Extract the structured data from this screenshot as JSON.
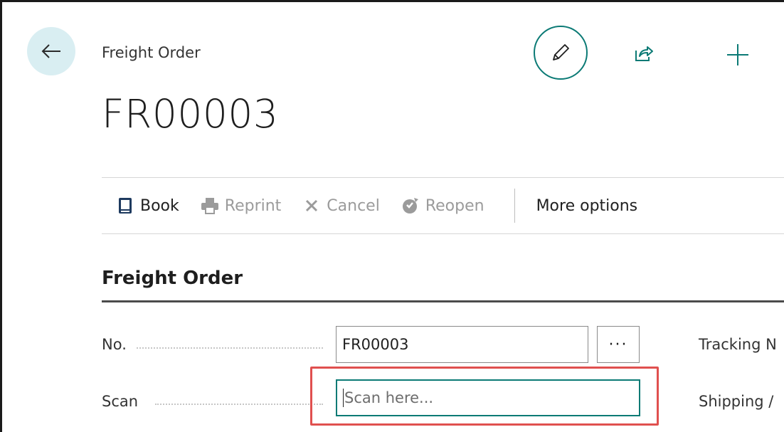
{
  "header": {
    "caption": "Freight Order",
    "record_no": "FR00003"
  },
  "icons": {
    "back": "arrow-left-icon",
    "edit": "pencil-icon",
    "share": "share-icon",
    "new": "plus-icon"
  },
  "actions": {
    "book": "Book",
    "reprint": "Reprint",
    "cancel": "Cancel",
    "reopen": "Reopen",
    "more": "More options"
  },
  "section": {
    "title": "Freight Order"
  },
  "fields": {
    "no_label": "No.",
    "no_value": "FR00003",
    "lookup": "···",
    "scan_label": "Scan",
    "scan_placeholder": "Scan here...",
    "tracking_label": "Tracking N",
    "shipping_label": "Shipping /"
  },
  "colors": {
    "accent": "#0b7a75",
    "back_bg": "#d9eef2",
    "highlight": "#e0504f"
  }
}
